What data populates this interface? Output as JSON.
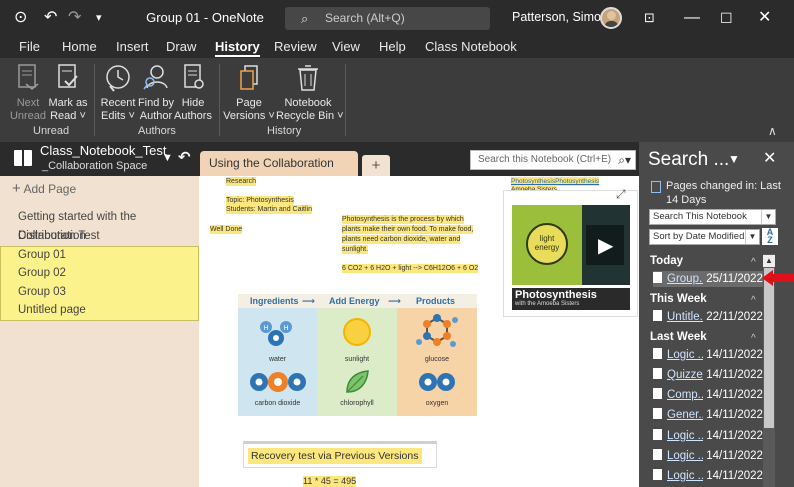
{
  "titlebar": {
    "title": "Group 01  -  OneNote",
    "search_placeholder": "Search (Alt+Q)",
    "user": "Patterson, Simon",
    "icons": [
      "back-icon",
      "undo-icon",
      "redo-icon",
      "customize-icon",
      "ribbon-display-icon",
      "minimize-icon",
      "maximize-icon",
      "close-icon"
    ]
  },
  "menu": {
    "tabs": [
      "File",
      "Home",
      "Insert",
      "Draw",
      "History",
      "Review",
      "View",
      "Help",
      "Class Notebook"
    ],
    "active": "History"
  },
  "ribbon": {
    "next_unread": "Next\nUnread",
    "mark_as_read": "Mark as\nRead ˅",
    "recent_edits": "Recent\nEdits ˅",
    "find_by_author": "Find by\nAuthor",
    "hide_authors": "Hide\nAuthors",
    "page_versions": "Page\nVersions ˅",
    "notebook_recycle_bin": "Notebook\nRecycle Bin ˅",
    "group_unread": "Unread",
    "group_authors": "Authors",
    "group_history": "History"
  },
  "notebook": {
    "name": "Class_Notebook_Test",
    "section_group": "_Collaboration Space",
    "section_tab": "Using the Collaboration Space",
    "add_tab": "+",
    "search_placeholder": "Search this Notebook (Ctrl+E)"
  },
  "pages": {
    "add_page": "Add Page",
    "items": [
      {
        "label": "Getting started with the Collaboration",
        "selected": false
      },
      {
        "label": "Distribution Test",
        "selected": false
      },
      {
        "label": "Group 01",
        "selected": true
      },
      {
        "label": "Group 02",
        "selected": true
      },
      {
        "label": "Group 03",
        "selected": true
      },
      {
        "label": "Untitled page",
        "selected": true
      }
    ]
  },
  "canvas": {
    "research": "Research",
    "topic": "Topic: Photosynthesis",
    "students": "Students: Martin and Caitlin",
    "well_done": "Well Done",
    "para1": "Photosynthesis is the process by which",
    "para2": "plants make their own food.  To make food,",
    "para3": "plants need carbon dioxide, water and",
    "para4": "sunlight.",
    "equation": "6 CO2 + 6 H2O + light --> C6H12O6 + 6 O2",
    "link1": "PhotosynthesisPhotosynthesis",
    "link2": "Amoeba Sisters",
    "diagram": {
      "ingredients": "Ingredients",
      "add_energy": "Add Energy",
      "products": "Products",
      "water": "water",
      "carbon_dioxide": "carbon dioxide",
      "sunlight": "sunlight",
      "chlorophyll": "chlorophyll",
      "glucose": "glucose",
      "oxygen": "oxygen"
    },
    "video": {
      "light_energy": "light\nenergy",
      "caption": "Photosynthesis",
      "byline": "with the Amoeba Sisters"
    },
    "recovery": "Recovery test via Previous Versions",
    "math": "11 * 45 = 495"
  },
  "search_pane": {
    "title": "Search ...",
    "info": "Pages changed in: Last 14 Days",
    "scope": "Search This Notebook",
    "sort": "Sort by Date Modified",
    "sort_icon": "A\nZ",
    "today": "Today",
    "this_week": "This Week",
    "last_week": "Last Week",
    "today_results": [
      {
        "name": "Group...",
        "date": "25/11/2022"
      }
    ],
    "week_results": [
      {
        "name": "Untitle...",
        "date": "22/11/2022"
      }
    ],
    "last_week_results": [
      {
        "name": "Logic ...",
        "date": "14/11/2022"
      },
      {
        "name": "Quizzes",
        "date": "14/11/2022"
      },
      {
        "name": "Comp...",
        "date": "14/11/2022"
      },
      {
        "name": "Gener...",
        "date": "14/11/2022"
      },
      {
        "name": "Logic ...",
        "date": "14/11/2022"
      },
      {
        "name": "Logic ...",
        "date": "14/11/2022"
      },
      {
        "name": "Logic ...",
        "date": "14/11/2022"
      }
    ]
  },
  "colors": {
    "accent_red": "#e0101a",
    "selected_page": "#fcf28c",
    "section_tab": "#f1d4b6"
  }
}
